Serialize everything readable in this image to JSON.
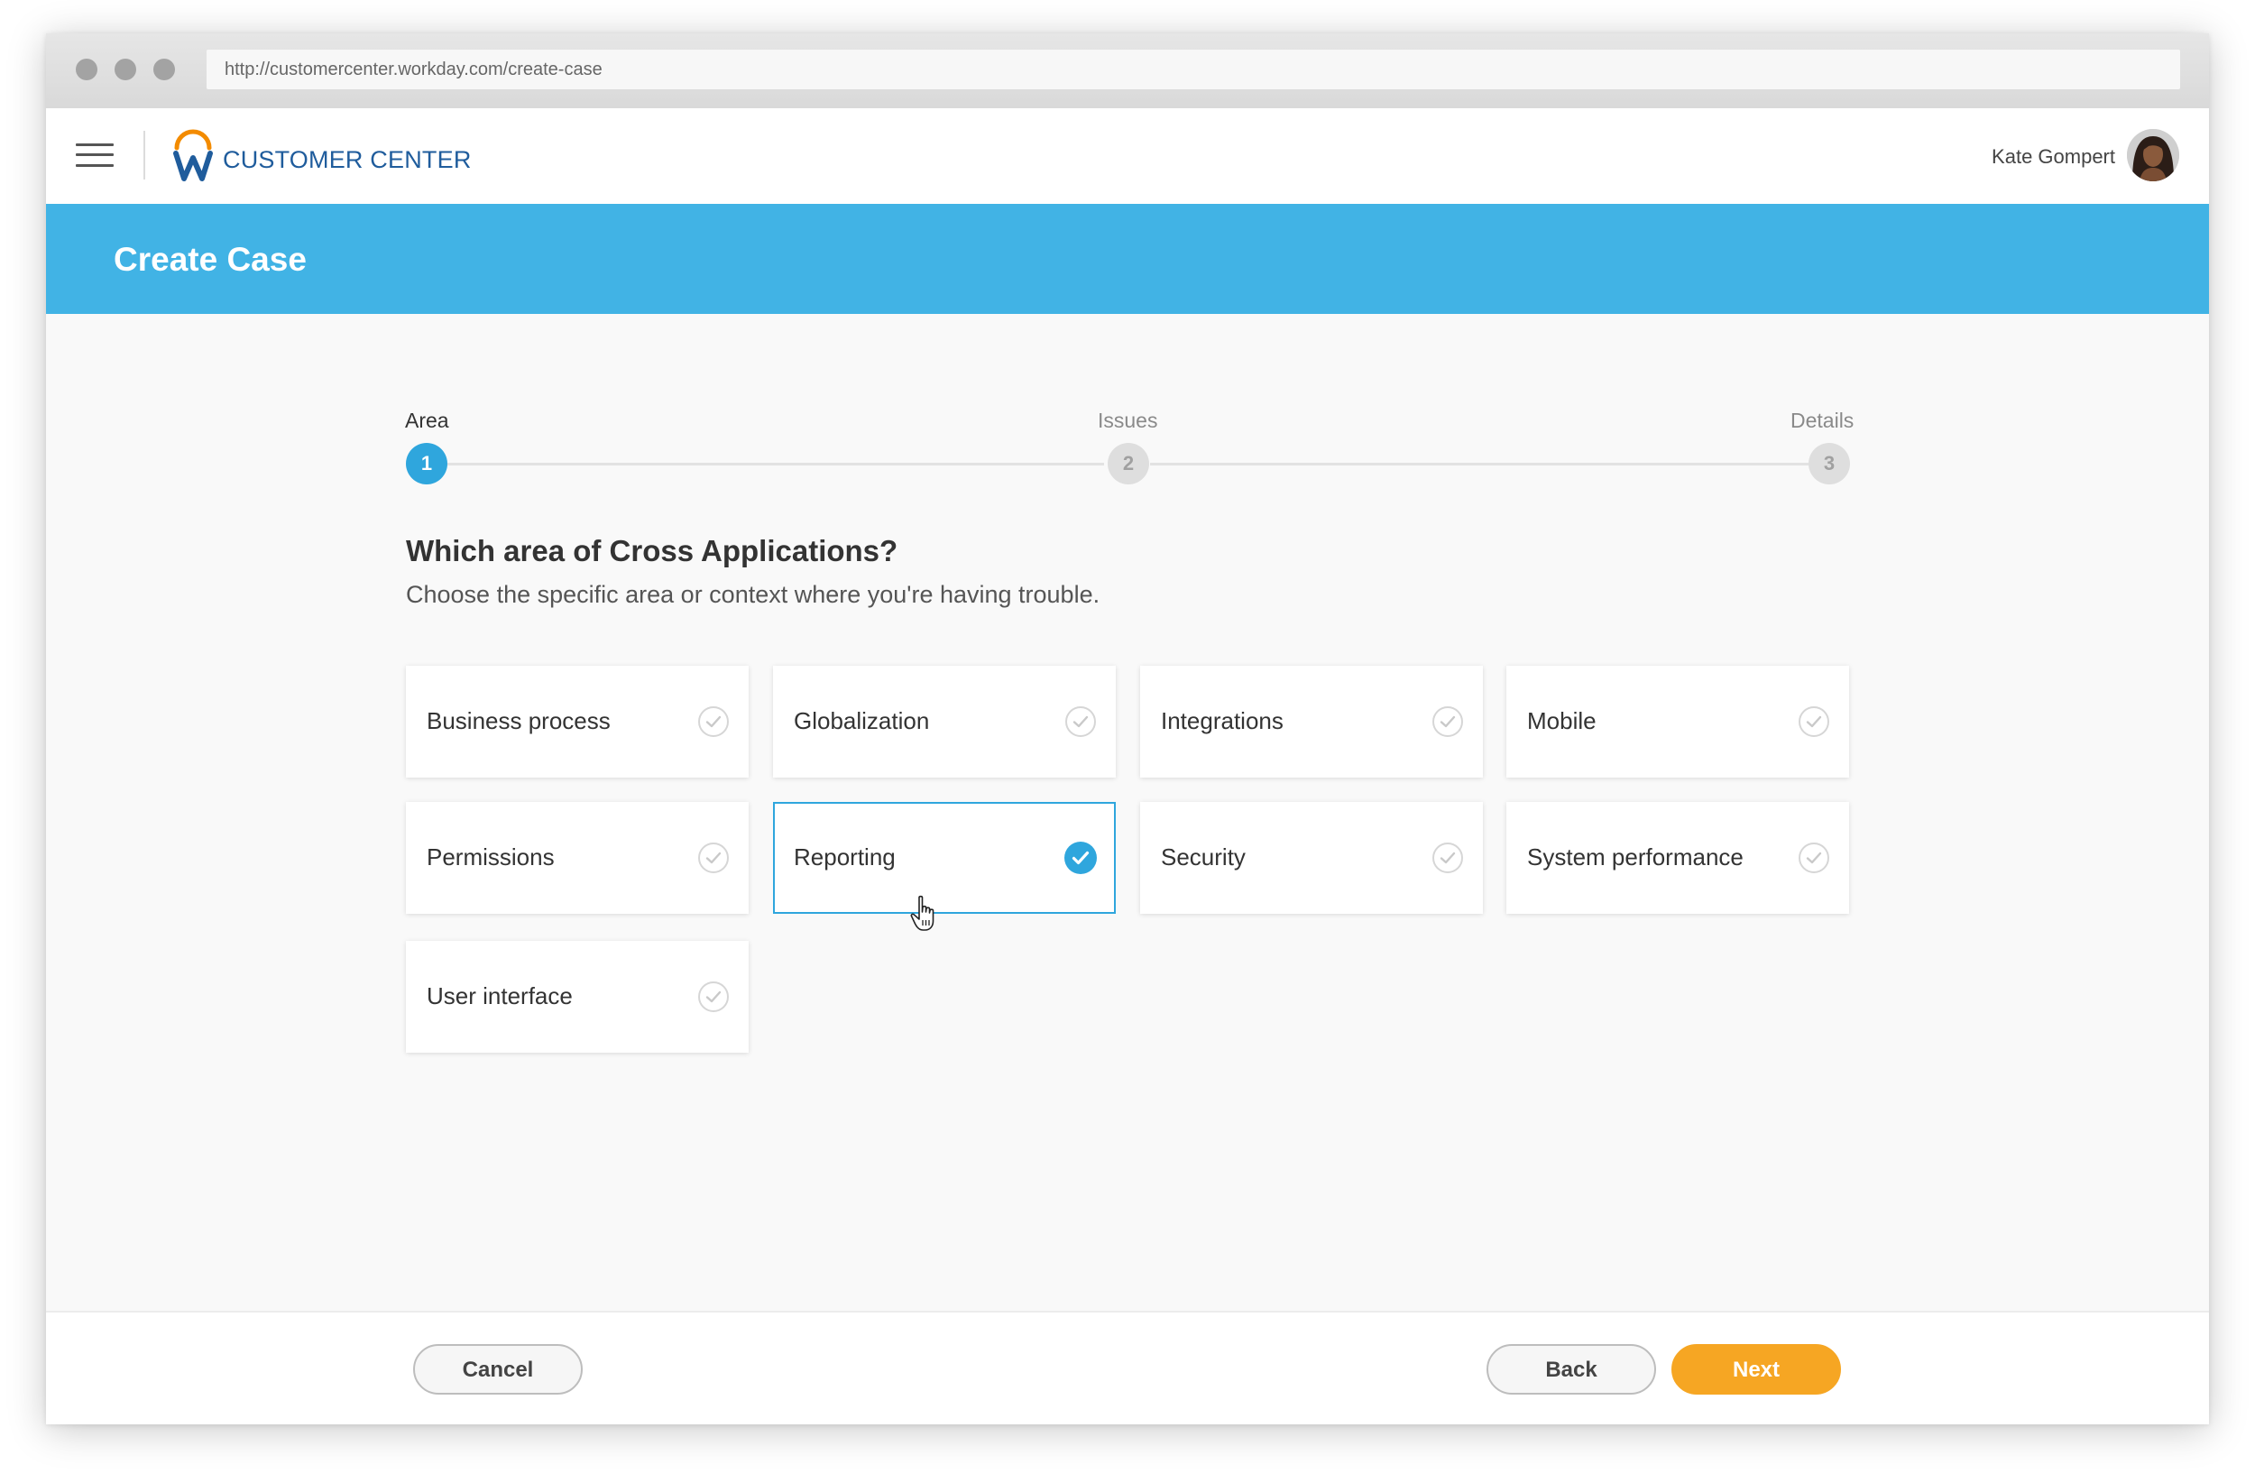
{
  "browser": {
    "url": "http://customercenter.workday.com/create-case"
  },
  "header": {
    "brand": "CUSTOMER CENTER",
    "user_name": "Kate Gompert"
  },
  "banner": {
    "title": "Create Case"
  },
  "stepper": {
    "steps": [
      {
        "label": "Area",
        "number": "1",
        "state": "active"
      },
      {
        "label": "Issues",
        "number": "2",
        "state": "inactive"
      },
      {
        "label": "Details",
        "number": "3",
        "state": "inactive"
      }
    ]
  },
  "main": {
    "question": "Which area of Cross Applications?",
    "subtext": "Choose the specific area or context where you're having trouble.",
    "options": [
      {
        "label": "Business process",
        "selected": false
      },
      {
        "label": "Globalization",
        "selected": false
      },
      {
        "label": "Integrations",
        "selected": false
      },
      {
        "label": "Mobile",
        "selected": false
      },
      {
        "label": "Permissions",
        "selected": false
      },
      {
        "label": "Reporting",
        "selected": true
      },
      {
        "label": "Security",
        "selected": false
      },
      {
        "label": "System performance",
        "selected": false
      },
      {
        "label": "User interface",
        "selected": false
      }
    ]
  },
  "footer": {
    "cancel_label": "Cancel",
    "back_label": "Back",
    "next_label": "Next"
  },
  "colors": {
    "banner": "#41b3e5",
    "accent_blue": "#2fa6dd",
    "next_button": "#f6a623",
    "logo_orange": "#f38b00",
    "logo_blue": "#1f5c9c"
  },
  "icons": {
    "menu": "hamburger-menu-icon",
    "logo": "workday-logo-icon",
    "option_check": "check-circle-icon",
    "cursor": "hand-pointer-icon"
  }
}
